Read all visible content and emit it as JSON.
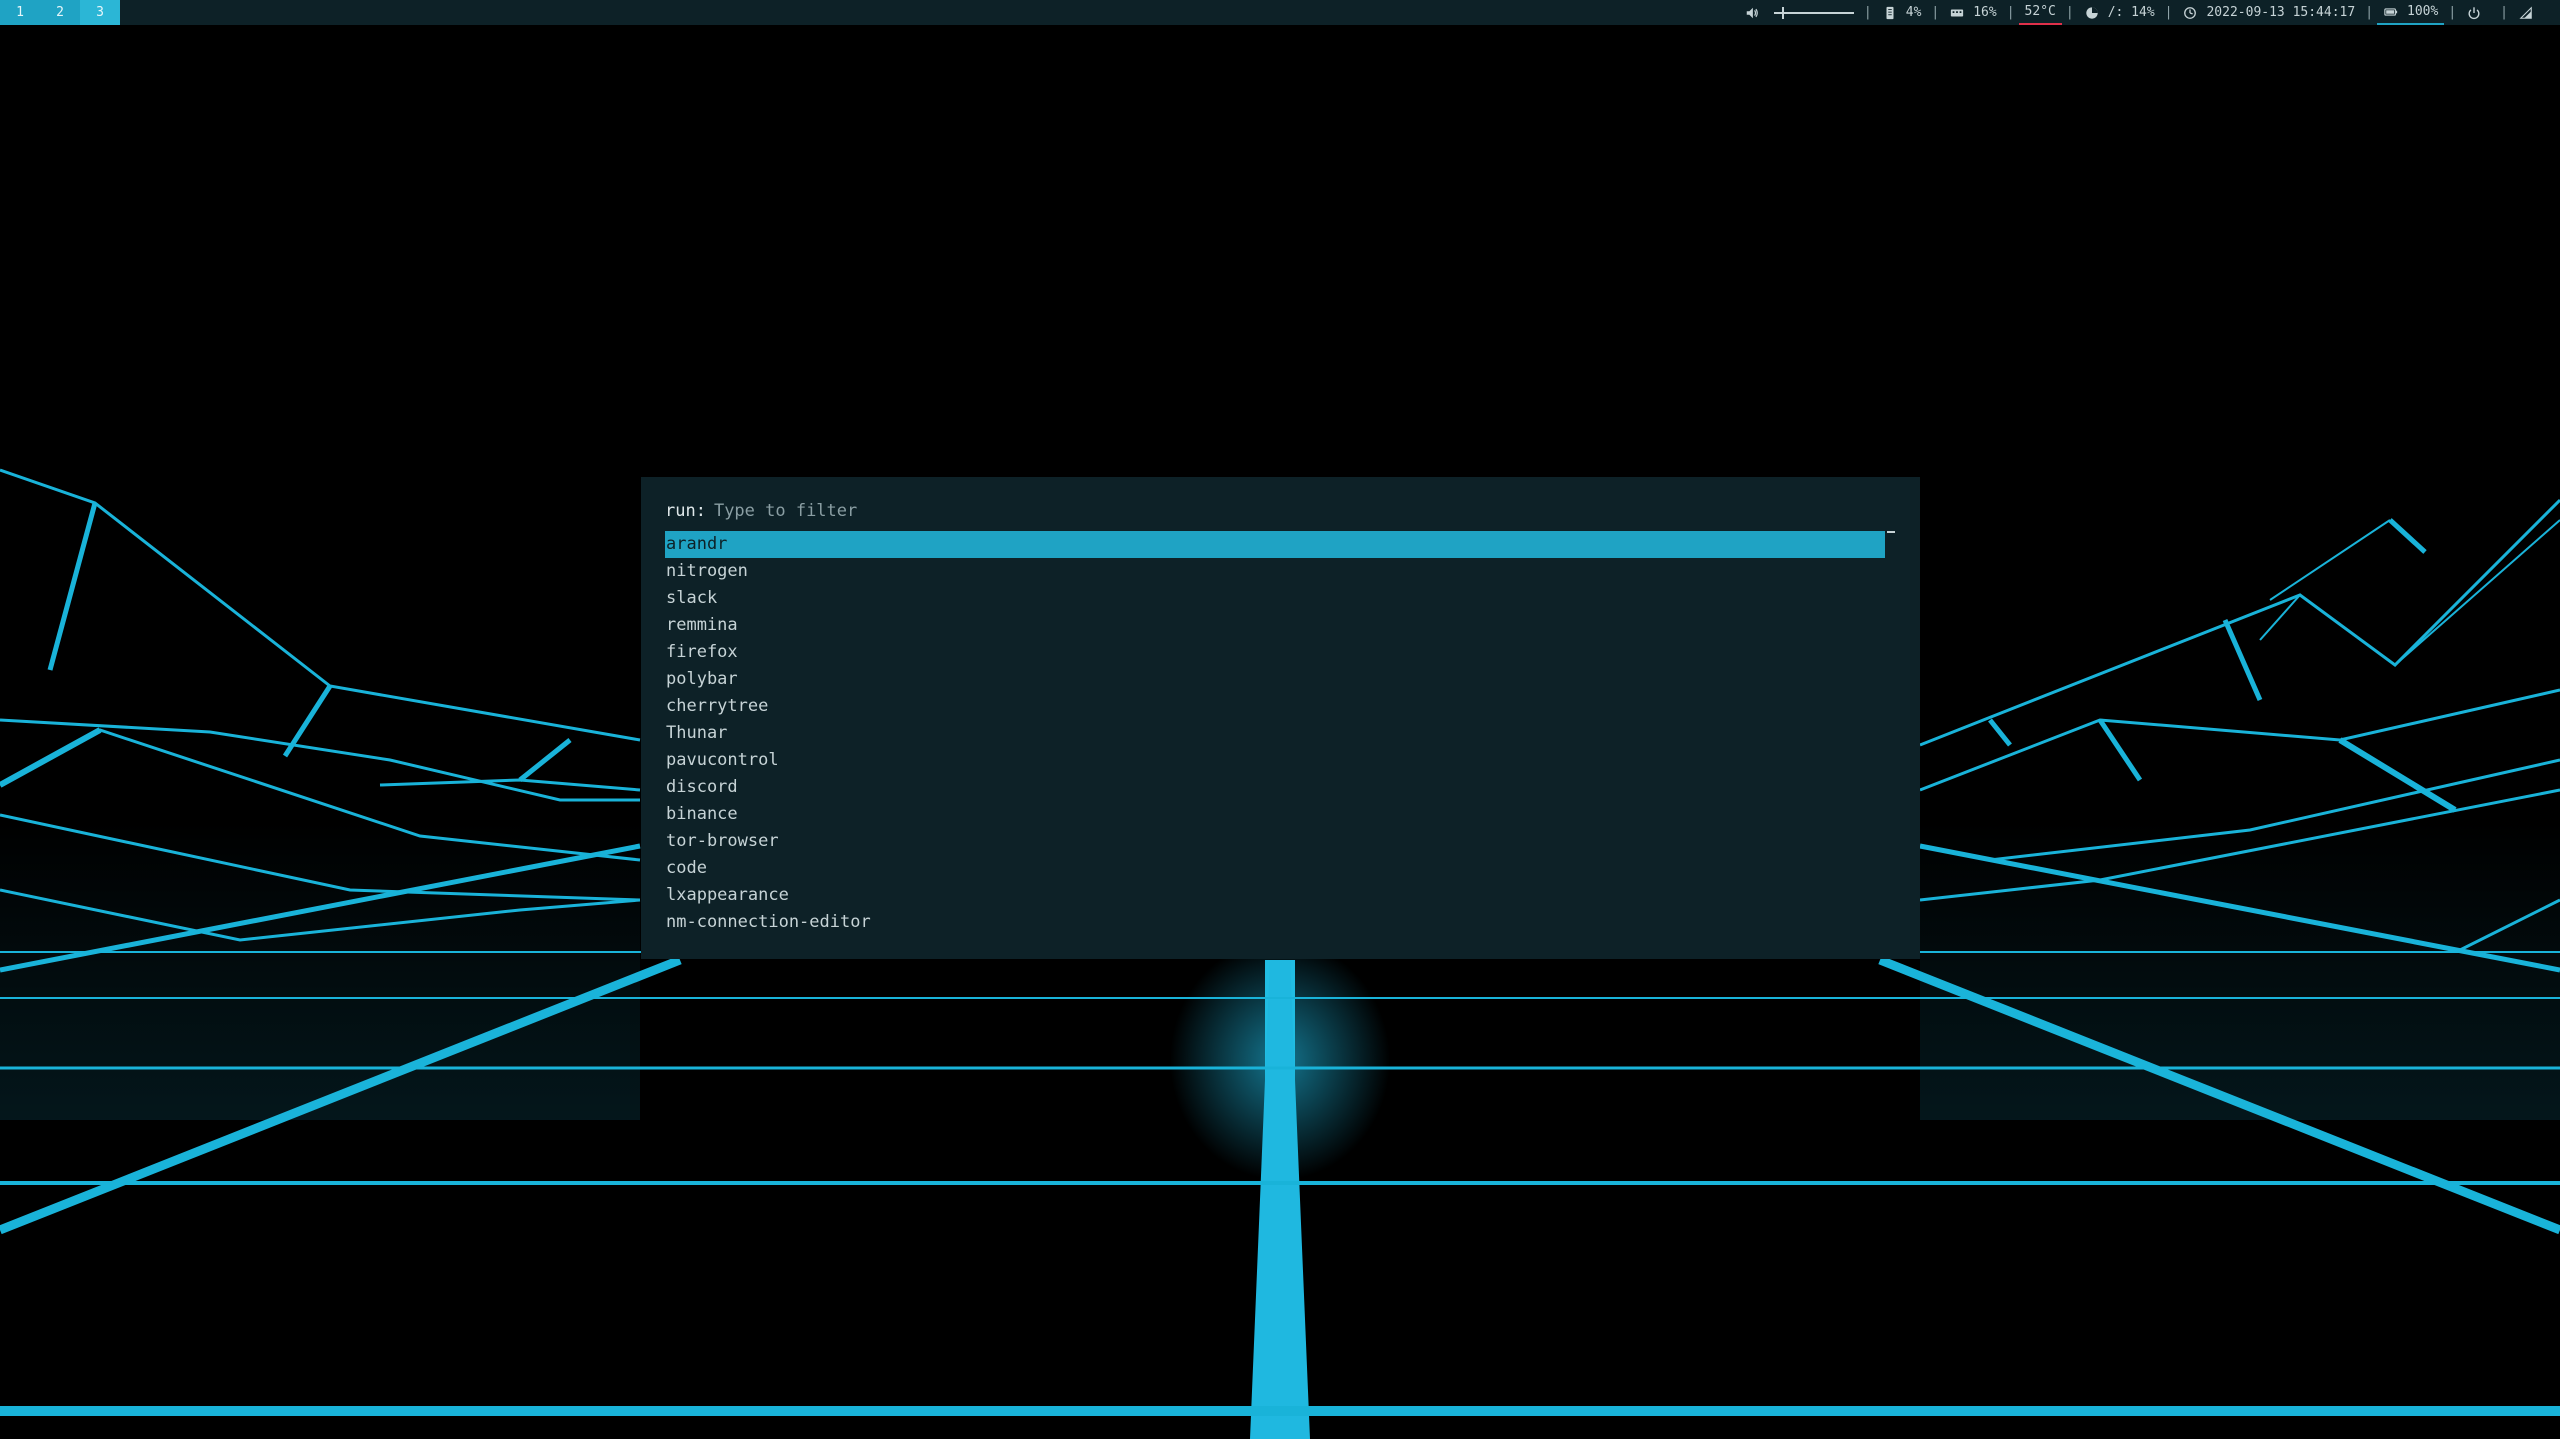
{
  "workspaces": [
    {
      "label": "1",
      "active": false
    },
    {
      "label": "2",
      "active": false
    },
    {
      "label": "3",
      "active": true
    }
  ],
  "status": {
    "volume_level": 0.1,
    "memory_value": "4%",
    "cpu_value": "16%",
    "temperature_value": "52°C",
    "filesystem_value": "/: 14%",
    "datetime_value": "2022-09-13 15:44:17",
    "battery_value": "100%",
    "separator": "|"
  },
  "launcher": {
    "prompt": "run:",
    "placeholder": "Type to filter",
    "entries": [
      "arandr",
      "nitrogen",
      "slack",
      "remmina",
      "firefox",
      "polybar",
      "cherrytree",
      "Thunar",
      "pavucontrol",
      "discord",
      "binance",
      "tor-browser",
      "code",
      "lxappearance",
      "nm-connection-editor"
    ],
    "selected_index": 0
  },
  "colors": {
    "accent": "#1fa3c4",
    "bar_background": "#0d2127",
    "text": "#c6d3d6",
    "temperature_alert": "#e0304a",
    "wallpaper_line": "#19b3d9"
  }
}
